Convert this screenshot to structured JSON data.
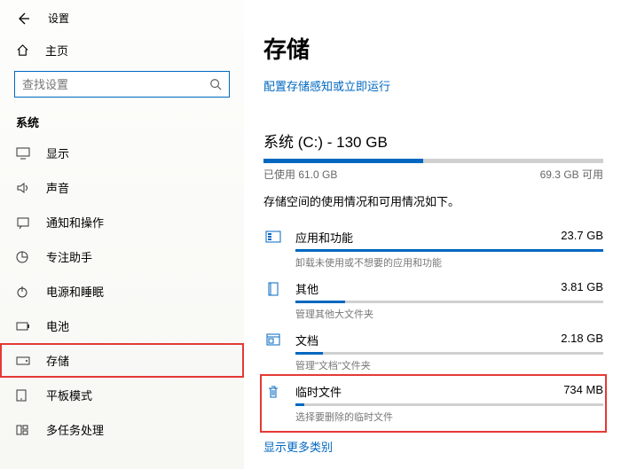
{
  "header": {
    "settings": "设置",
    "home": "主页",
    "search_placeholder": "查找设置"
  },
  "sidebar": {
    "section": "系统",
    "items": [
      {
        "label": "显示"
      },
      {
        "label": "声音"
      },
      {
        "label": "通知和操作"
      },
      {
        "label": "专注助手"
      },
      {
        "label": "电源和睡眠"
      },
      {
        "label": "电池"
      },
      {
        "label": "存储"
      },
      {
        "label": "平板模式"
      },
      {
        "label": "多任务处理"
      }
    ]
  },
  "main": {
    "title": "存储",
    "sense_link": "配置存储感知或立即运行",
    "drive_title": "系统 (C:) - 130 GB",
    "used_label": "已使用 61.0 GB",
    "free_label": "69.3 GB 可用",
    "used_pct": 47,
    "usage_text": "存储空间的使用情况和可用情况如下。",
    "categories": [
      {
        "name": "应用和功能",
        "size": "23.7 GB",
        "sub": "卸载未使用或不想要的应用和功能",
        "pct": 100
      },
      {
        "name": "其他",
        "size": "3.81 GB",
        "sub": "管理其他大文件夹",
        "pct": 16
      },
      {
        "name": "文档",
        "size": "2.18 GB",
        "sub": "管理\"文档\"文件夹",
        "pct": 9
      },
      {
        "name": "临时文件",
        "size": "734 MB",
        "sub": "选择要删除的临时文件",
        "pct": 3
      }
    ],
    "more_link": "显示更多类别"
  }
}
